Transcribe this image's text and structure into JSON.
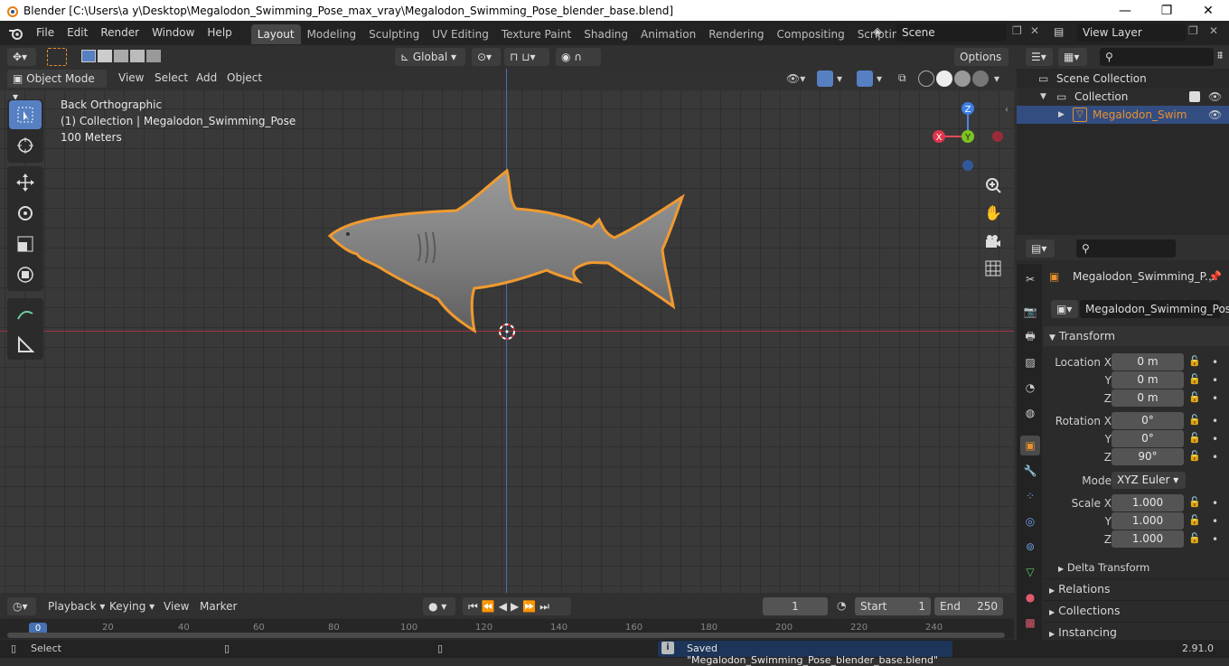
{
  "window": {
    "title": "Blender [C:\\Users\\a y\\Desktop\\Megalodon_Swimming_Pose_max_vray\\Megalodon_Swimming_Pose_blender_base.blend]",
    "min": "—",
    "max": "❐",
    "close": "✕"
  },
  "menu": [
    "File",
    "Edit",
    "Render",
    "Window",
    "Help"
  ],
  "workspaces": [
    "Layout",
    "Modeling",
    "Sculpting",
    "UV Editing",
    "Texture Paint",
    "Shading",
    "Animation",
    "Rendering",
    "Compositing",
    "Scripting"
  ],
  "workspace_add": "+",
  "scene": "Scene",
  "view_layer": "View Layer",
  "toolbar2": {
    "orientation": "Global",
    "options": "Options"
  },
  "viewport_header": {
    "mode": "Object Mode",
    "menus": [
      "View",
      "Select",
      "Add",
      "Object"
    ]
  },
  "overlay": {
    "view": "Back Orthographic",
    "collection": "(1) Collection | Megalodon_Swimming_Pose",
    "scale": "100 Meters"
  },
  "gizmo": {
    "z": "Z",
    "x": "X",
    "y": "Y"
  },
  "outliner": {
    "root": "Scene Collection",
    "collection": "Collection",
    "object": "Megalodon_Swimming_Pose"
  },
  "properties": {
    "object_name": "Megalodon_Swimming_P...",
    "data_name": "Megalodon_Swimming_Pose",
    "transform": "Transform",
    "location_label": "Location X",
    "location": [
      "0 m",
      "0 m",
      "0 m"
    ],
    "rotation_label": "Rotation X",
    "rotation": [
      "0°",
      "0°",
      "90°"
    ],
    "mode_label": "Mode",
    "mode": "XYZ Euler",
    "scale_label": "Scale X",
    "scale": [
      "1.000",
      "1.000",
      "1.000"
    ],
    "y_label": "Y",
    "z_label": "Z",
    "delta": "Delta Transform",
    "sections": [
      "Relations",
      "Collections",
      "Instancing"
    ]
  },
  "timeline": {
    "menus": [
      "Playback",
      "Keying",
      "View",
      "Marker"
    ],
    "current": "1",
    "start_label": "Start",
    "start": "1",
    "end_label": "End",
    "end": "250",
    "ticks": [
      "0",
      "20",
      "40",
      "60",
      "80",
      "100",
      "120",
      "140",
      "160",
      "180",
      "200",
      "220",
      "240"
    ]
  },
  "status": {
    "select": "Select",
    "message": "Saved \"Megalodon_Swimming_Pose_blender_base.blend\"",
    "version": "2.91.0"
  },
  "colors": {
    "accent": "#4772b3",
    "selection": "#e8912d",
    "header": "#232323"
  }
}
